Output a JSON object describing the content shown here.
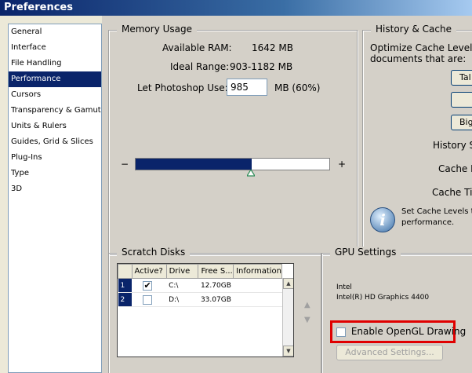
{
  "window": {
    "title": "Preferences"
  },
  "sidebar": {
    "items": [
      {
        "label": "General",
        "selected": false
      },
      {
        "label": "Interface",
        "selected": false
      },
      {
        "label": "File Handling",
        "selected": false
      },
      {
        "label": "Performance",
        "selected": true
      },
      {
        "label": "Cursors",
        "selected": false
      },
      {
        "label": "Transparency & Gamut",
        "selected": false
      },
      {
        "label": "Units & Rulers",
        "selected": false
      },
      {
        "label": "Guides, Grid & Slices",
        "selected": false
      },
      {
        "label": "Plug-Ins",
        "selected": false
      },
      {
        "label": "Type",
        "selected": false
      },
      {
        "label": "3D",
        "selected": false
      }
    ]
  },
  "memory": {
    "legend": "Memory Usage",
    "available_label": "Available RAM:",
    "available_value": "1642 MB",
    "ideal_label": "Ideal Range:",
    "ideal_value": "903-1182 MB",
    "let_label": "Let Photoshop Use:",
    "let_value": "985",
    "let_unit": "MB (60%)",
    "slider_min": "−",
    "slider_max": "+",
    "slider_fraction": 0.6
  },
  "history": {
    "legend": "History & Cache",
    "optimize_line1": "Optimize Cache Levels a",
    "optimize_line2": "documents that are:",
    "btn_tall": "Tal",
    "btn_default": "",
    "btn_big": "Big",
    "history_states_label": "History St",
    "cache_levels_label": "Cache L",
    "cache_tile_label": "Cache Til",
    "info_line1": "Set Cache Levels to",
    "info_line2": "performance."
  },
  "scratch": {
    "legend": "Scratch Disks",
    "columns": [
      "Active?",
      "Drive",
      "Free S...",
      "Information"
    ],
    "rows": [
      {
        "num": "1",
        "active": true,
        "check": "✔",
        "drive": "C:\\",
        "free": "12.70GB",
        "info": ""
      },
      {
        "num": "2",
        "active": false,
        "check": "",
        "drive": "D:\\",
        "free": "33.07GB",
        "info": ""
      }
    ],
    "up_arrow": "▲",
    "down_arrow": "▼"
  },
  "gpu": {
    "legend": "GPU Settings",
    "vendor": "Intel",
    "model": "Intel(R) HD Graphics 4400",
    "opengl_label": "Enable OpenGL Drawing",
    "opengl_checked": false,
    "advanced_label": "Advanced Settings..."
  },
  "colors": {
    "selection": "#0a246a",
    "highlight": "#e00000"
  }
}
